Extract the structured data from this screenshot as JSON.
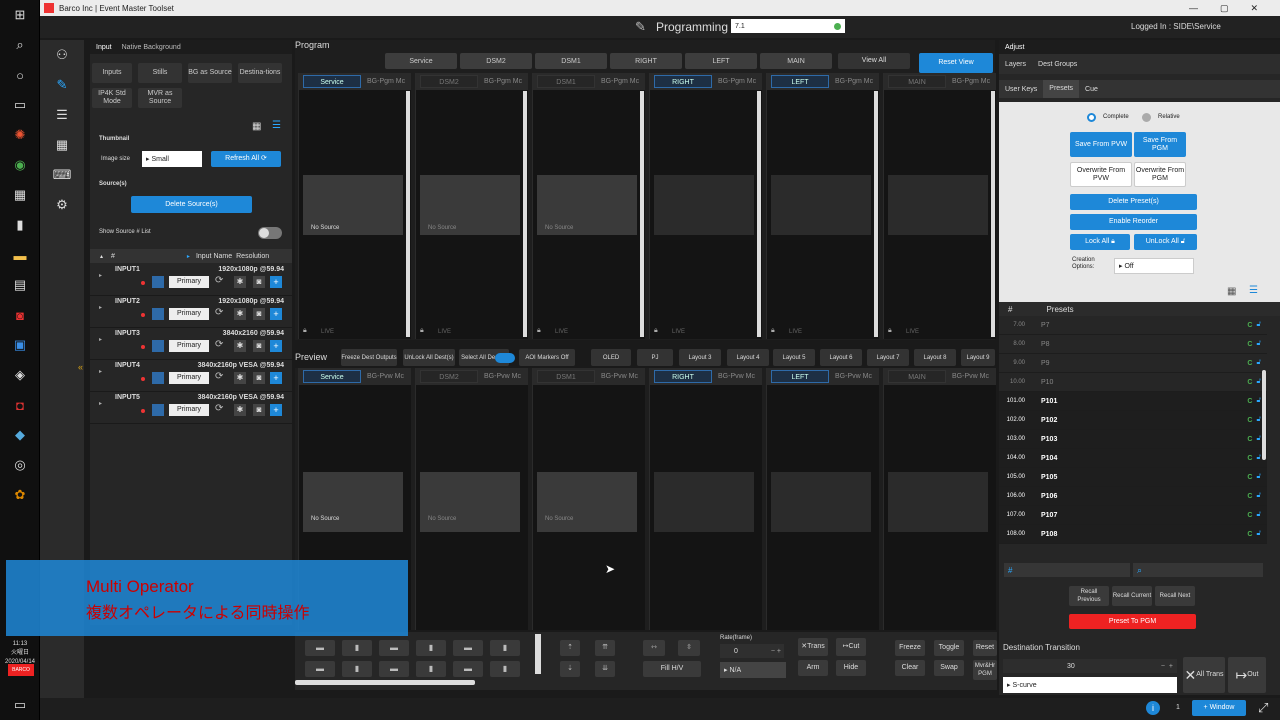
{
  "window": {
    "title": "Barco Inc | Event Master Toolset"
  },
  "header": {
    "mode": "Programming",
    "version": "7.1",
    "login": "Logged In : SIDE\\Service"
  },
  "taskbar": {
    "time": "11:13",
    "day": "火曜日",
    "date": "2020/04/14",
    "brand": "BARCO"
  },
  "left": {
    "tabs": [
      "Input",
      "Native Background"
    ],
    "subtabs": [
      "Inputs",
      "Stills",
      "BG as Source",
      "Destina-tions",
      "IP4K Std Mode",
      "MVR as Source"
    ],
    "thumbnail_label": "Thumbnail",
    "image_size_label": "Image size",
    "image_size_value": "Small",
    "refresh_label": "Refresh All",
    "sources_label": "Source(s)",
    "delete_label": "Delete Source(s)",
    "show_list_label": "Show Source # List",
    "col_hash": "#",
    "col_name": "Input Name",
    "col_res": "Resolution",
    "inputs": [
      {
        "name": "INPUT1",
        "res": "1920x1080p @59.94",
        "state": "Primary"
      },
      {
        "name": "INPUT2",
        "res": "1920x1080p @59.94",
        "state": "Primary"
      },
      {
        "name": "INPUT3",
        "res": "3840x2160 @59.94",
        "state": "Primary"
      },
      {
        "name": "INPUT4",
        "res": "3840x2160p VESA @59.94",
        "state": "Primary"
      },
      {
        "name": "INPUT5",
        "res": "3840x2160p VESA @59.94",
        "state": "Primary"
      }
    ]
  },
  "program": {
    "label": "Program",
    "dests": [
      "Service",
      "DSM2",
      "DSM1",
      "RIGHT",
      "LEFT",
      "MAIN"
    ],
    "view_all": "View All",
    "reset_view": "Reset View",
    "bg_label": "BG-Pgm Mc",
    "no_source": "No Source",
    "live": "LIVE"
  },
  "preview": {
    "label": "Preview",
    "buttons": [
      "Freeze Dest Outputs",
      "UnLock All Dest(s)",
      "Select All Dest(s)",
      "AOI Markers Off",
      "OLED",
      "PJ",
      "Layout 3",
      "Layout 4",
      "Layout 5",
      "Layout 6",
      "Layout 7",
      "Layout 8",
      "Layout 9"
    ],
    "bg_label": "BG-Pvw Mc",
    "no_source": "No Source"
  },
  "bottom": {
    "fill": "Fill H/V",
    "rate_label": "Rate(frame)",
    "rate_value": "0",
    "na": "N/A",
    "trans": "Trans",
    "cut": "Cut",
    "arm": "Arm",
    "hide": "Hide",
    "freeze": "Freeze",
    "toggle": "Toggle",
    "clear": "Clear",
    "swap": "Swap",
    "reset": "Reset",
    "mvr": "Mvr&Hr PGM"
  },
  "right": {
    "tabs": [
      "Adjust"
    ],
    "subtabs1": [
      "Layers",
      "Dest Groups"
    ],
    "subtabs2": [
      "User Keys",
      "Presets",
      "Cue"
    ],
    "complete": "Complete",
    "relative": "Relative",
    "save_pvw": "Save From PVW",
    "save_pgm": "Save From PGM",
    "over_pvw": "Overwrite From PVW",
    "over_pgm": "Overwrite From PGM",
    "delete_presets": "Delete Preset(s)",
    "enable_reorder": "Enable Reorder",
    "lock_all": "Lock All",
    "unlock_all": "UnLock All",
    "creation_label": "Creation Options:",
    "creation_value": "Off",
    "list_hash": "#",
    "list_title": "Presets",
    "presets": [
      {
        "num": "7.00",
        "name": "P7"
      },
      {
        "num": "8.00",
        "name": "P8"
      },
      {
        "num": "9.00",
        "name": "P9"
      },
      {
        "num": "10.00",
        "name": "P10"
      },
      {
        "num": "101.00",
        "name": "P101"
      },
      {
        "num": "102.00",
        "name": "P102"
      },
      {
        "num": "103.00",
        "name": "P103"
      },
      {
        "num": "104.00",
        "name": "P104"
      },
      {
        "num": "105.00",
        "name": "P105"
      },
      {
        "num": "106.00",
        "name": "P106"
      },
      {
        "num": "107.00",
        "name": "P107"
      },
      {
        "num": "108.00",
        "name": "P108"
      }
    ],
    "recall_prev": "Recall Previous",
    "recall_cur": "Recall Current",
    "recall_next": "Recall Next",
    "preset_pgm": "Preset To PGM",
    "dest_transition": "Destination Transition",
    "trans_value": "30",
    "scurve": "S-curve",
    "all_trans": "All Trans",
    "out": "Out"
  },
  "status": {
    "page": "1",
    "window_btn": "+ Window"
  },
  "overlay": {
    "title": "Multi Operator",
    "subtitle": "複数オペレータによる同時操作"
  }
}
